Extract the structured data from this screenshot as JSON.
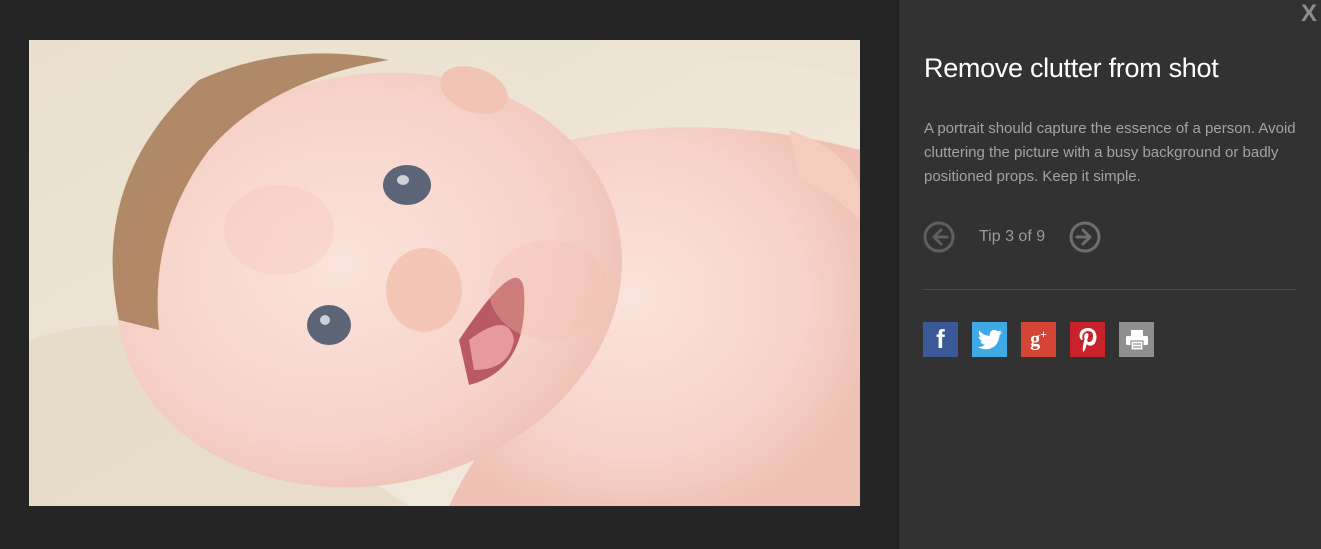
{
  "close": {
    "label": "X"
  },
  "photo": {
    "alt": "Smiling baby lying on a cream blanket"
  },
  "tip": {
    "title": "Remove clutter from shot",
    "body": "A portrait should capture the essence of a person. Avoid cluttering the picture with a busy background or badly positioned props. Keep it simple.",
    "counter": "Tip 3 of 9",
    "prev_icon": "arrow-left-circle-icon",
    "next_icon": "arrow-right-circle-icon"
  },
  "share": {
    "facebook": {
      "glyph": "f",
      "icon": "facebook-icon",
      "color": "#3b5998"
    },
    "twitter": {
      "icon": "twitter-icon",
      "color": "#3fa9e6"
    },
    "google_plus": {
      "glyph": "g",
      "glyph_sup": "+",
      "icon": "google-plus-icon",
      "color": "#d54536"
    },
    "pinterest": {
      "icon": "pinterest-icon",
      "color": "#c8232c"
    },
    "print": {
      "icon": "print-icon",
      "color": "#8f8f8f"
    }
  },
  "colors": {
    "background": "#262626",
    "panel": "#323232",
    "title": "#ffffff",
    "body_text": "#a3a3a3"
  }
}
